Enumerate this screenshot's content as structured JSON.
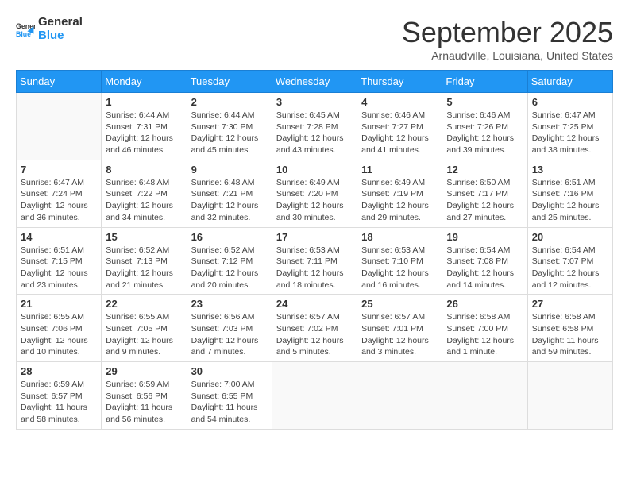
{
  "header": {
    "logo_general": "General",
    "logo_blue": "Blue",
    "month": "September 2025",
    "location": "Arnaudville, Louisiana, United States"
  },
  "days_of_week": [
    "Sunday",
    "Monday",
    "Tuesday",
    "Wednesday",
    "Thursday",
    "Friday",
    "Saturday"
  ],
  "weeks": [
    [
      {
        "day": "",
        "info": ""
      },
      {
        "day": "1",
        "info": "Sunrise: 6:44 AM\nSunset: 7:31 PM\nDaylight: 12 hours\nand 46 minutes."
      },
      {
        "day": "2",
        "info": "Sunrise: 6:44 AM\nSunset: 7:30 PM\nDaylight: 12 hours\nand 45 minutes."
      },
      {
        "day": "3",
        "info": "Sunrise: 6:45 AM\nSunset: 7:28 PM\nDaylight: 12 hours\nand 43 minutes."
      },
      {
        "day": "4",
        "info": "Sunrise: 6:46 AM\nSunset: 7:27 PM\nDaylight: 12 hours\nand 41 minutes."
      },
      {
        "day": "5",
        "info": "Sunrise: 6:46 AM\nSunset: 7:26 PM\nDaylight: 12 hours\nand 39 minutes."
      },
      {
        "day": "6",
        "info": "Sunrise: 6:47 AM\nSunset: 7:25 PM\nDaylight: 12 hours\nand 38 minutes."
      }
    ],
    [
      {
        "day": "7",
        "info": "Sunrise: 6:47 AM\nSunset: 7:24 PM\nDaylight: 12 hours\nand 36 minutes."
      },
      {
        "day": "8",
        "info": "Sunrise: 6:48 AM\nSunset: 7:22 PM\nDaylight: 12 hours\nand 34 minutes."
      },
      {
        "day": "9",
        "info": "Sunrise: 6:48 AM\nSunset: 7:21 PM\nDaylight: 12 hours\nand 32 minutes."
      },
      {
        "day": "10",
        "info": "Sunrise: 6:49 AM\nSunset: 7:20 PM\nDaylight: 12 hours\nand 30 minutes."
      },
      {
        "day": "11",
        "info": "Sunrise: 6:49 AM\nSunset: 7:19 PM\nDaylight: 12 hours\nand 29 minutes."
      },
      {
        "day": "12",
        "info": "Sunrise: 6:50 AM\nSunset: 7:17 PM\nDaylight: 12 hours\nand 27 minutes."
      },
      {
        "day": "13",
        "info": "Sunrise: 6:51 AM\nSunset: 7:16 PM\nDaylight: 12 hours\nand 25 minutes."
      }
    ],
    [
      {
        "day": "14",
        "info": "Sunrise: 6:51 AM\nSunset: 7:15 PM\nDaylight: 12 hours\nand 23 minutes."
      },
      {
        "day": "15",
        "info": "Sunrise: 6:52 AM\nSunset: 7:13 PM\nDaylight: 12 hours\nand 21 minutes."
      },
      {
        "day": "16",
        "info": "Sunrise: 6:52 AM\nSunset: 7:12 PM\nDaylight: 12 hours\nand 20 minutes."
      },
      {
        "day": "17",
        "info": "Sunrise: 6:53 AM\nSunset: 7:11 PM\nDaylight: 12 hours\nand 18 minutes."
      },
      {
        "day": "18",
        "info": "Sunrise: 6:53 AM\nSunset: 7:10 PM\nDaylight: 12 hours\nand 16 minutes."
      },
      {
        "day": "19",
        "info": "Sunrise: 6:54 AM\nSunset: 7:08 PM\nDaylight: 12 hours\nand 14 minutes."
      },
      {
        "day": "20",
        "info": "Sunrise: 6:54 AM\nSunset: 7:07 PM\nDaylight: 12 hours\nand 12 minutes."
      }
    ],
    [
      {
        "day": "21",
        "info": "Sunrise: 6:55 AM\nSunset: 7:06 PM\nDaylight: 12 hours\nand 10 minutes."
      },
      {
        "day": "22",
        "info": "Sunrise: 6:55 AM\nSunset: 7:05 PM\nDaylight: 12 hours\nand 9 minutes."
      },
      {
        "day": "23",
        "info": "Sunrise: 6:56 AM\nSunset: 7:03 PM\nDaylight: 12 hours\nand 7 minutes."
      },
      {
        "day": "24",
        "info": "Sunrise: 6:57 AM\nSunset: 7:02 PM\nDaylight: 12 hours\nand 5 minutes."
      },
      {
        "day": "25",
        "info": "Sunrise: 6:57 AM\nSunset: 7:01 PM\nDaylight: 12 hours\nand 3 minutes."
      },
      {
        "day": "26",
        "info": "Sunrise: 6:58 AM\nSunset: 7:00 PM\nDaylight: 12 hours\nand 1 minute."
      },
      {
        "day": "27",
        "info": "Sunrise: 6:58 AM\nSunset: 6:58 PM\nDaylight: 11 hours\nand 59 minutes."
      }
    ],
    [
      {
        "day": "28",
        "info": "Sunrise: 6:59 AM\nSunset: 6:57 PM\nDaylight: 11 hours\nand 58 minutes."
      },
      {
        "day": "29",
        "info": "Sunrise: 6:59 AM\nSunset: 6:56 PM\nDaylight: 11 hours\nand 56 minutes."
      },
      {
        "day": "30",
        "info": "Sunrise: 7:00 AM\nSunset: 6:55 PM\nDaylight: 11 hours\nand 54 minutes."
      },
      {
        "day": "",
        "info": ""
      },
      {
        "day": "",
        "info": ""
      },
      {
        "day": "",
        "info": ""
      },
      {
        "day": "",
        "info": ""
      }
    ]
  ]
}
